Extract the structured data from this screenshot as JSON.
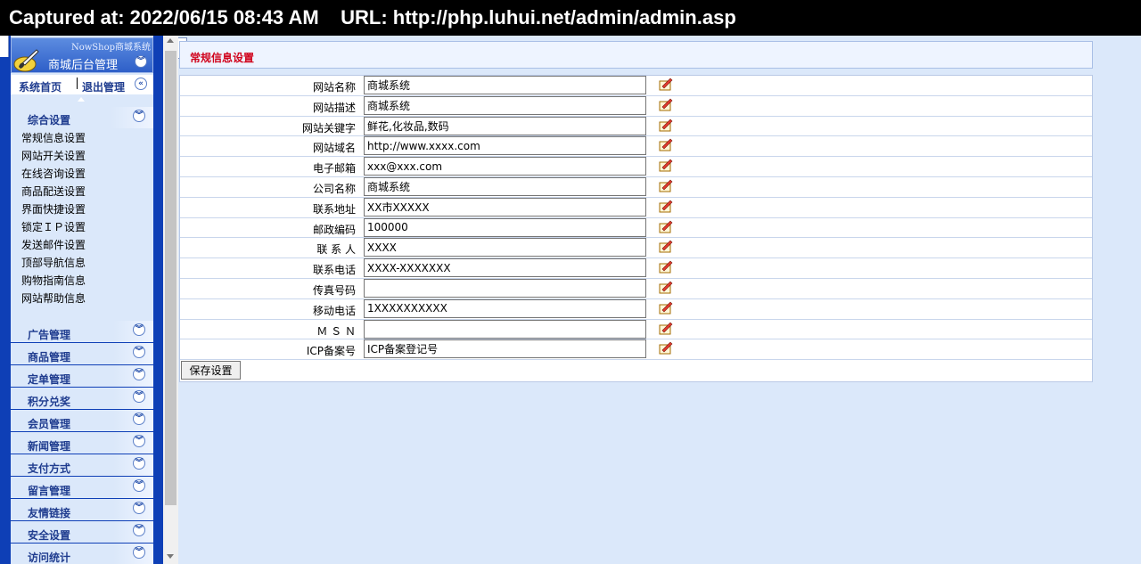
{
  "banner": {
    "text": "Captured at: 2022/06/15 08:43 AM    URL: http://php.luhui.net/admin/admin.asp"
  },
  "sidebar": {
    "system_name": "NowShop商城系统",
    "title": "商城后台管理",
    "home": "系统首页",
    "logout": "退出管理",
    "group": {
      "label": "综合设置",
      "items": [
        "常规信息设置",
        "网站开关设置",
        "在线咨询设置",
        "商品配送设置",
        "界面快捷设置",
        "锁定ＩＰ设置",
        "发送邮件设置",
        "顶部导航信息",
        "购物指南信息",
        "网站帮助信息"
      ]
    },
    "menus": [
      "广告管理",
      "商品管理",
      "定单管理",
      "积分兑奖",
      "会员管理",
      "新闻管理",
      "支付方式",
      "留言管理",
      "友情链接",
      "安全设置",
      "访问统计"
    ]
  },
  "main": {
    "title": "常规信息设置",
    "fields": [
      {
        "label": "网站名称",
        "value": "商城系统"
      },
      {
        "label": "网站描述",
        "value": "商城系统"
      },
      {
        "label": "网站关键字",
        "value": "鲜花,化妆品,数码"
      },
      {
        "label": "网站域名",
        "value": "http://www.xxxx.com"
      },
      {
        "label": "电子邮箱",
        "value": "xxx@xxx.com"
      },
      {
        "label": "公司名称",
        "value": "商城系统"
      },
      {
        "label": "联系地址",
        "value": "XX市XXXXX"
      },
      {
        "label": "邮政编码",
        "value": "100000"
      },
      {
        "label": "联 系 人",
        "value": "XXXX"
      },
      {
        "label": "联系电话",
        "value": "XXXX-XXXXXXX"
      },
      {
        "label": "传真号码",
        "value": ""
      },
      {
        "label": "移动电话",
        "value": "1XXXXXXXXXX"
      },
      {
        "label": "Ｍ Ｓ Ｎ",
        "value": ""
      },
      {
        "label": "ICP备案号",
        "value": "ICP备案登记号"
      }
    ],
    "save_label": "保存设置"
  },
  "colors": {
    "sidebar_blue": "#0e3fb6",
    "title_red": "#d0021b",
    "page_bg": "#dbe8fa"
  },
  "icons": {
    "edit": "edit-note-icon",
    "expand": "chevron-double-down-icon",
    "collapse": "chevron-double-left-icon",
    "logo": "brush-logo-icon"
  }
}
